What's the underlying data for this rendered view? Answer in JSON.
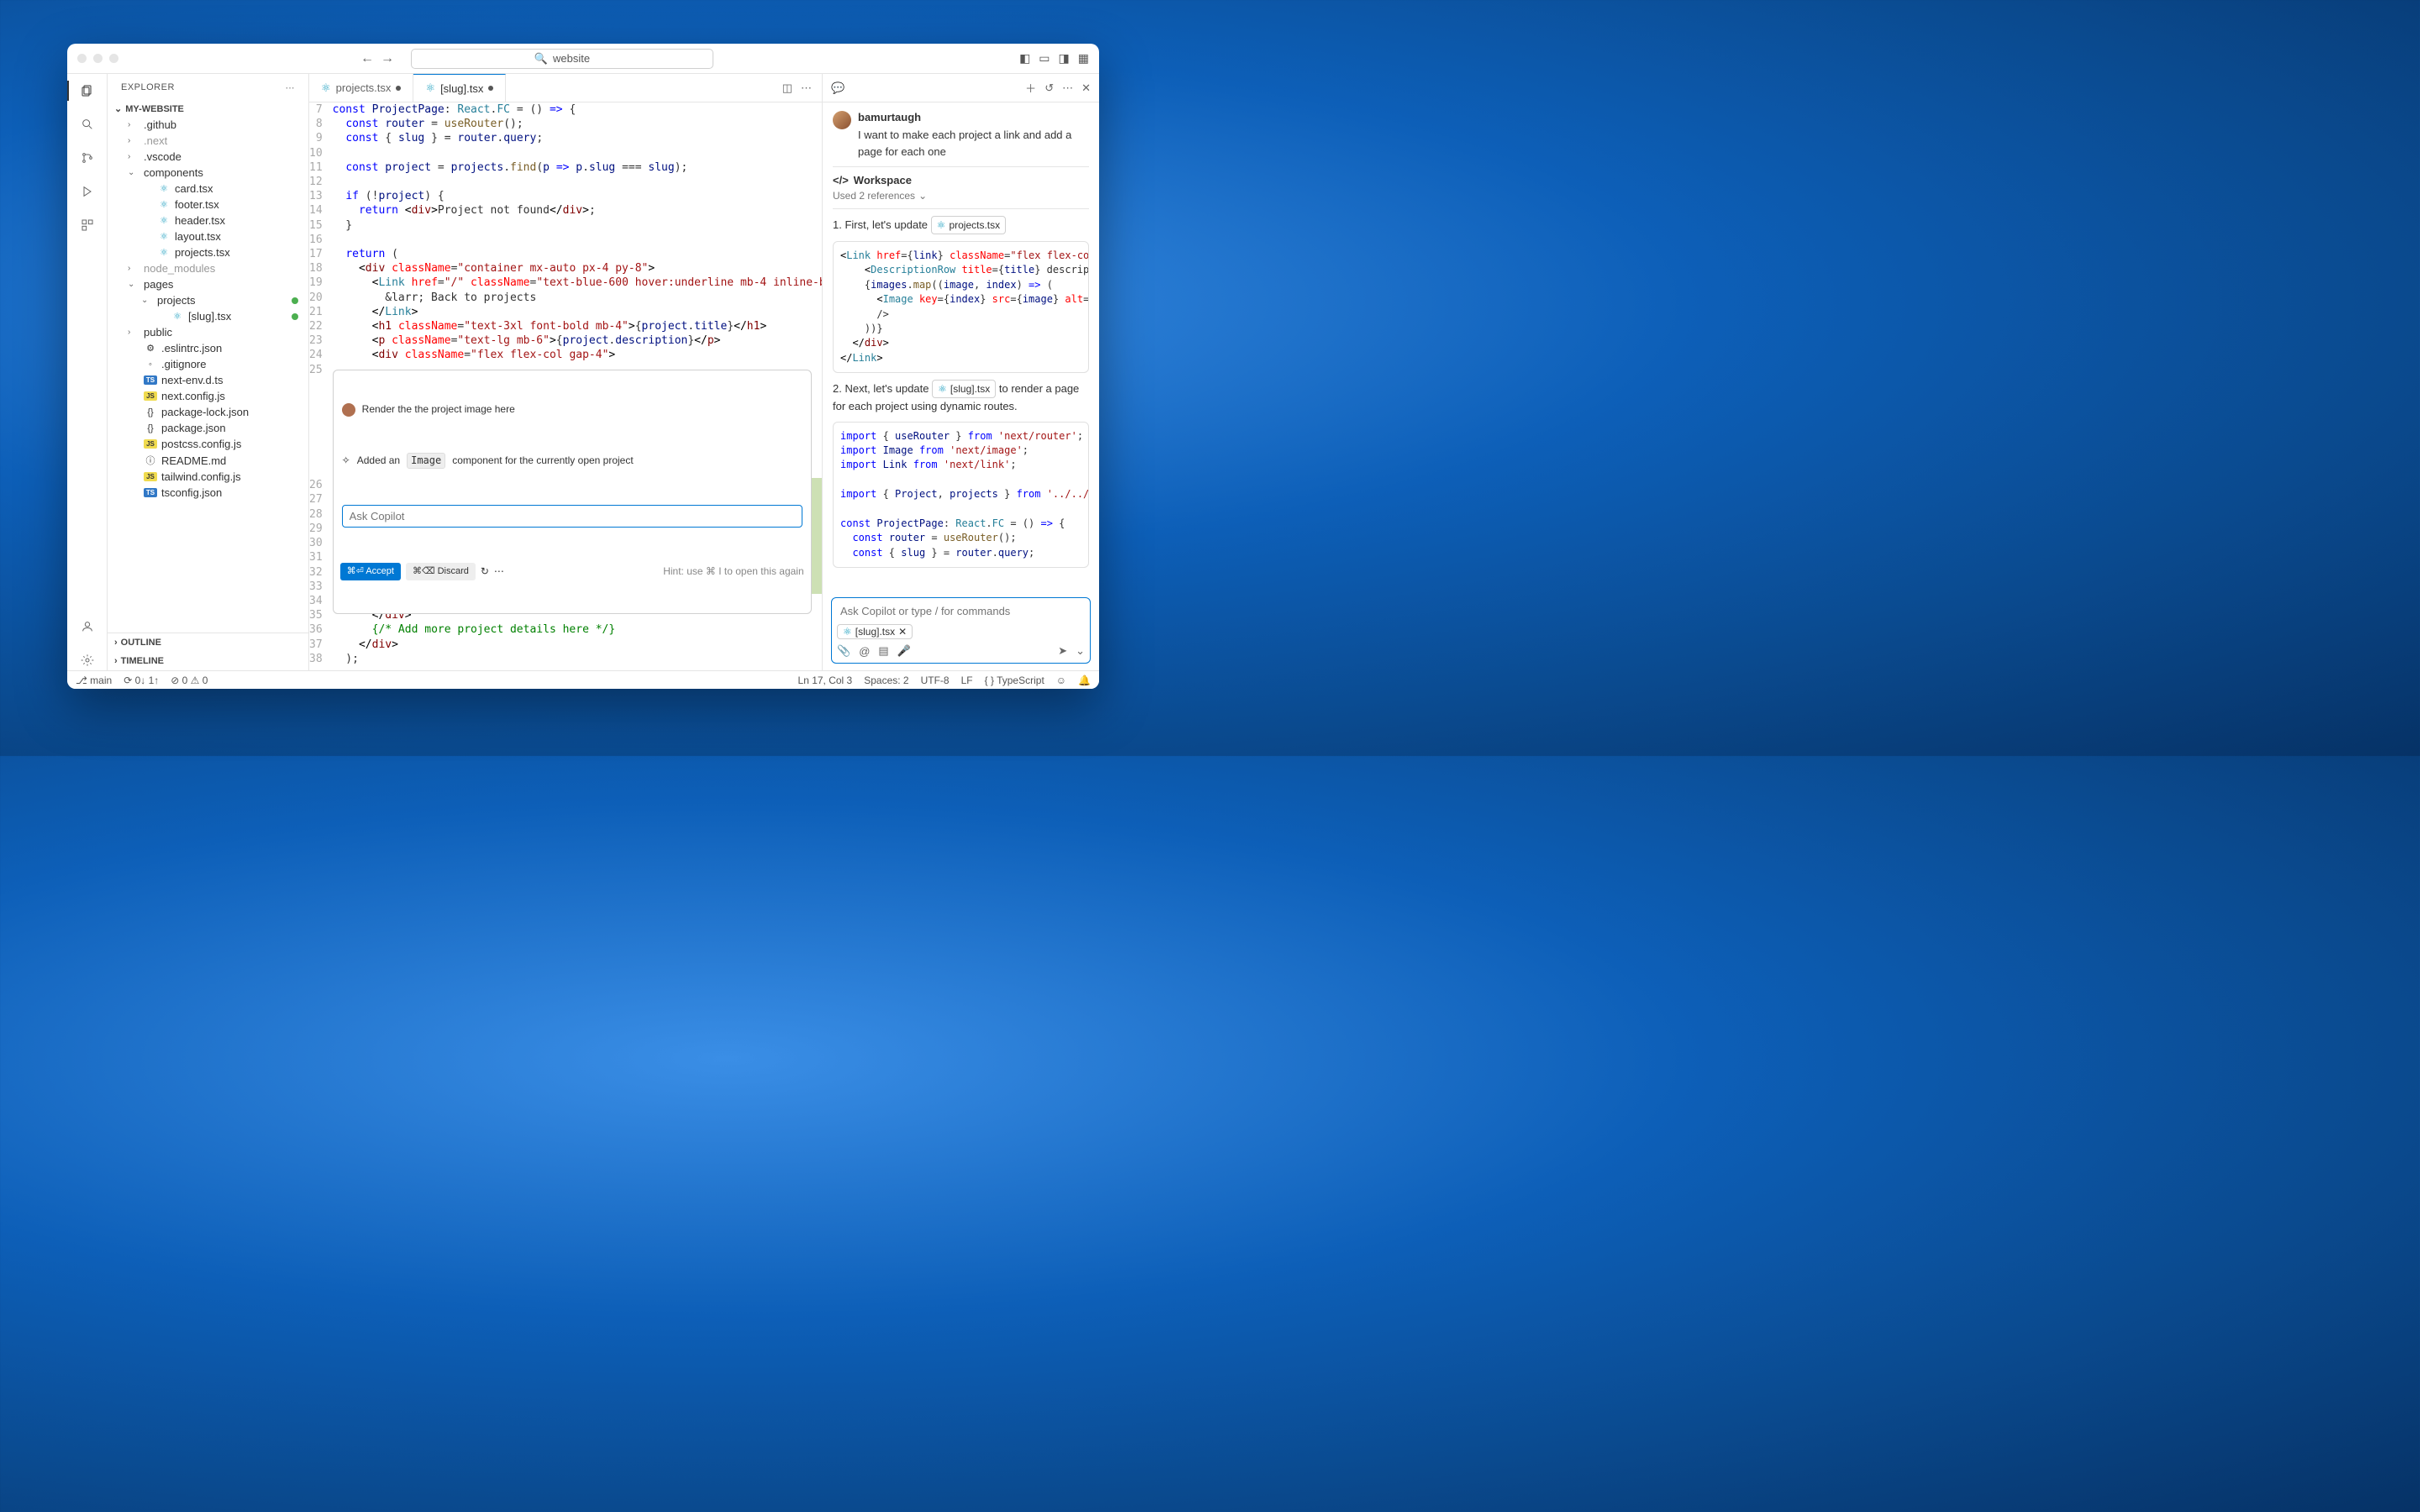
{
  "titlebar": {
    "search_text": "website"
  },
  "sidebar": {
    "head": "EXPLORER",
    "project": "MY-WEBSITE",
    "outline": "OUTLINE",
    "timeline": "TIMELINE",
    "tree": [
      {
        "name": ".github",
        "type": "folder",
        "indent": 1
      },
      {
        "name": ".next",
        "type": "folder",
        "indent": 1,
        "dim": true
      },
      {
        "name": ".vscode",
        "type": "folder",
        "indent": 1
      },
      {
        "name": "components",
        "type": "folder",
        "indent": 1,
        "open": true
      },
      {
        "name": "card.tsx",
        "type": "react",
        "indent": 2
      },
      {
        "name": "footer.tsx",
        "type": "react",
        "indent": 2
      },
      {
        "name": "header.tsx",
        "type": "react",
        "indent": 2
      },
      {
        "name": "layout.tsx",
        "type": "react",
        "indent": 2
      },
      {
        "name": "projects.tsx",
        "type": "react",
        "indent": 2
      },
      {
        "name": "node_modules",
        "type": "folder",
        "indent": 1,
        "dim": true
      },
      {
        "name": "pages",
        "type": "folder",
        "indent": 1,
        "open": true
      },
      {
        "name": "projects",
        "type": "folder",
        "indent": 2,
        "open": true,
        "dot": true
      },
      {
        "name": "[slug].tsx",
        "type": "react",
        "indent": 3,
        "dot": true
      },
      {
        "name": "public",
        "type": "folder",
        "indent": 1
      },
      {
        "name": ".eslintrc.json",
        "type": "json",
        "indent": 1,
        "icon": "⚙"
      },
      {
        "name": ".gitignore",
        "type": "text",
        "indent": 1,
        "icon": "◦"
      },
      {
        "name": "next-env.d.ts",
        "type": "ts",
        "indent": 1
      },
      {
        "name": "next.config.js",
        "type": "js",
        "indent": 1
      },
      {
        "name": "package-lock.json",
        "type": "json",
        "indent": 1,
        "icon": "{}"
      },
      {
        "name": "package.json",
        "type": "json",
        "indent": 1,
        "icon": "{}"
      },
      {
        "name": "postcss.config.js",
        "type": "js",
        "indent": 1
      },
      {
        "name": "README.md",
        "type": "info",
        "indent": 1,
        "icon": "ⓘ"
      },
      {
        "name": "tailwind.config.js",
        "type": "js",
        "indent": 1
      },
      {
        "name": "tsconfig.json",
        "type": "ts",
        "indent": 1
      }
    ]
  },
  "tabs": {
    "tab1": "projects.tsx",
    "tab2": "[slug].tsx"
  },
  "editor": {
    "line_start": 7,
    "inline": {
      "prompt": "Render the the project image here",
      "result_prefix": "Added an",
      "result_chip": "Image",
      "result_suffix": "component for the currently open project",
      "placeholder": "Ask Copilot",
      "accept": "⌘⏎ Accept",
      "discard": "⌘⌫ Discard",
      "hint": "Hint: use ⌘ I to open this again"
    }
  },
  "chat": {
    "username": "bamurtaugh",
    "usermsg": "I want to make each project a link and add a page for each one",
    "workspace": "Workspace",
    "refs": "Used 2 references",
    "step1_prefix": "1. First, let's update",
    "step1_chip": "projects.tsx",
    "step2_prefix": "2. Next, let's update",
    "step2_chip": "[slug].tsx",
    "step2_suffix": "to render a page for each project using dynamic routes.",
    "input_placeholder": "Ask Copilot or type / for commands",
    "chip": "[slug].tsx"
  },
  "statusbar": {
    "branch": "main",
    "sync": "0↓ 1↑",
    "errs": "0",
    "warns": "0",
    "pos": "Ln 17, Col 3",
    "spaces": "Spaces: 2",
    "enc": "UTF-8",
    "eol": "LF",
    "lang": "{ } TypeScript"
  }
}
